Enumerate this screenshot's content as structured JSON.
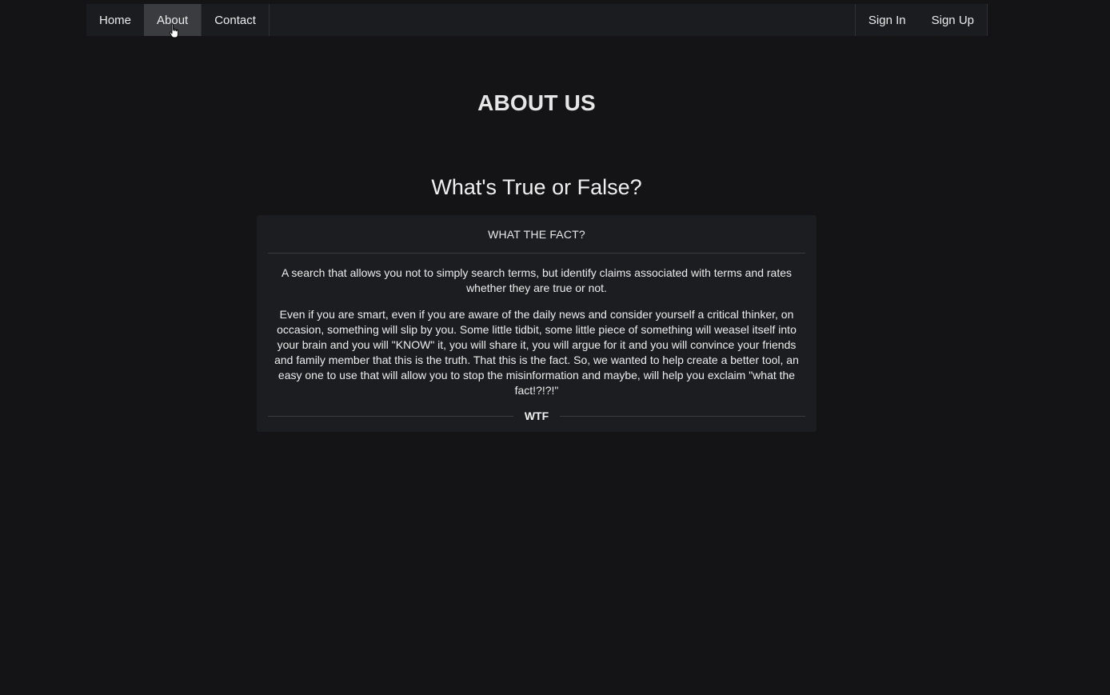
{
  "nav": {
    "left": [
      {
        "label": "Home"
      },
      {
        "label": "About"
      },
      {
        "label": "Contact"
      }
    ],
    "right": [
      {
        "label": "Sign In"
      },
      {
        "label": "Sign Up"
      }
    ],
    "active": "About"
  },
  "page": {
    "title": "ABOUT US",
    "heading": "What's True or False?"
  },
  "card": {
    "header": "WHAT THE FACT?",
    "paragraph1": "A search that allows you not to simply search terms, but identify claims associated with terms and rates whether they are true or not.",
    "paragraph2": "Even if you are smart, even if you are aware of the daily news and consider yourself a critical thinker, on occasion, something will slip by you. Some little tidbit, some little piece of something will weasel itself into your brain and you will \"KNOW\" it, you will share it, you will argue for it and you will convince your friends and family member that this is the truth. That this is the fact. So, we wanted to help create a better tool, an easy one to use that will allow you to stop the misinformation and maybe, will help you exclaim \"what the fact!?!?!\"",
    "divider_label": "WTF"
  },
  "colors": {
    "background": "#141417",
    "navbar": "#1b1c1f",
    "nav_active": "#3b3c3f",
    "card": "#1c1d20"
  },
  "icons": {
    "cursor": "hand-pointer-icon"
  }
}
